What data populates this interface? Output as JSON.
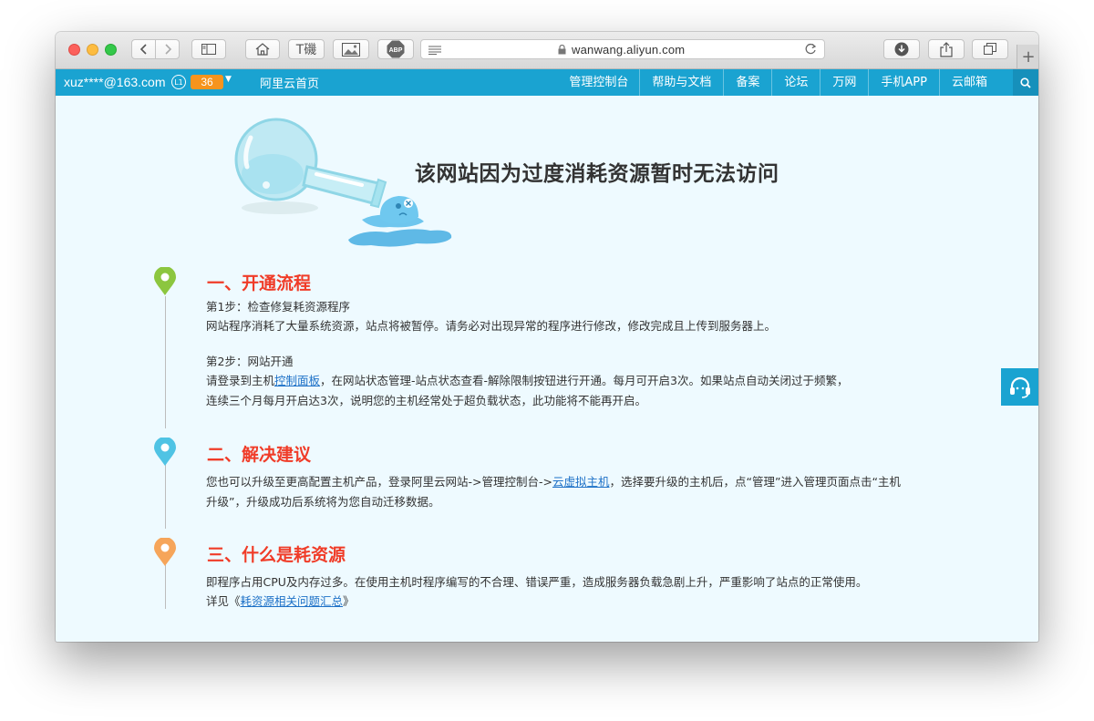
{
  "browser": {
    "url": "wanwang.aliyun.com",
    "toolbar_icons": [
      "back-icon",
      "forward-icon",
      "sidebar-icon",
      "home-icon",
      "font-icon",
      "image-icon",
      "adblock-icon",
      "reader-icon",
      "lock-icon",
      "reload-icon",
      "download-icon",
      "share-icon",
      "tabs-icon",
      "new-tab-icon"
    ],
    "abp_label": "ABP",
    "font_label": "T磯",
    "new_tab_label": "+"
  },
  "navbar": {
    "user": "xuz****@163.com",
    "level_badge": "L1",
    "points": "36",
    "caret": "▼",
    "home_link": "阿里云首页",
    "links": [
      "管理控制台",
      "帮助与文档",
      "备案",
      "论坛",
      "万网",
      "手机APP",
      "云邮箱"
    ]
  },
  "page": {
    "title": "该网站因为过度消耗资源暂时无法访问",
    "sections": [
      {
        "title": "一、开通流程",
        "pin_color": "#8cc63f",
        "step1_label": "第1步：检查修复耗资源程序",
        "step1_text": "网站程序消耗了大量系统资源，站点将被暂停。请务必对出现异常的程序进行修改，修改完成且上传到服务器上。",
        "step2_label": "第2步：网站开通",
        "step2_pre": "请登录到主机",
        "step2_link": "控制面板",
        "step2_post": "，在网站状态管理-站点状态查看-解除限制按钮进行开通。每月可开启3次。如果站点自动关闭过于频繁，",
        "step2_line2": "连续三个月每月开启达3次，说明您的主机经常处于超负载状态，此功能将不能再开启。"
      },
      {
        "title": "二、解决建议",
        "pin_color": "#4fc3e4",
        "line1_pre": "您也可以升级至更高配置主机产品，登录阿里云网站->管理控制台->",
        "line1_link": "云虚拟主机",
        "line1_post": "，选择要升级的主机后，点“管理”进入管理页面点击“主机",
        "line2": "升级”，升级成功后系统将为您自动迁移数据。"
      },
      {
        "title": "三、什么是耗资源",
        "pin_color": "#f6a55a",
        "line1": "即程序占用CPU及内存过多。在使用主机时程序编写的不合理、错误严重，造成服务器负载急剧上升，严重影响了站点的正常使用。",
        "line2_pre": "详见《",
        "line2_link": "耗资源相关问题汇总",
        "line2_post": "》"
      }
    ]
  },
  "support_widget": {
    "icon": "headset-icon"
  }
}
